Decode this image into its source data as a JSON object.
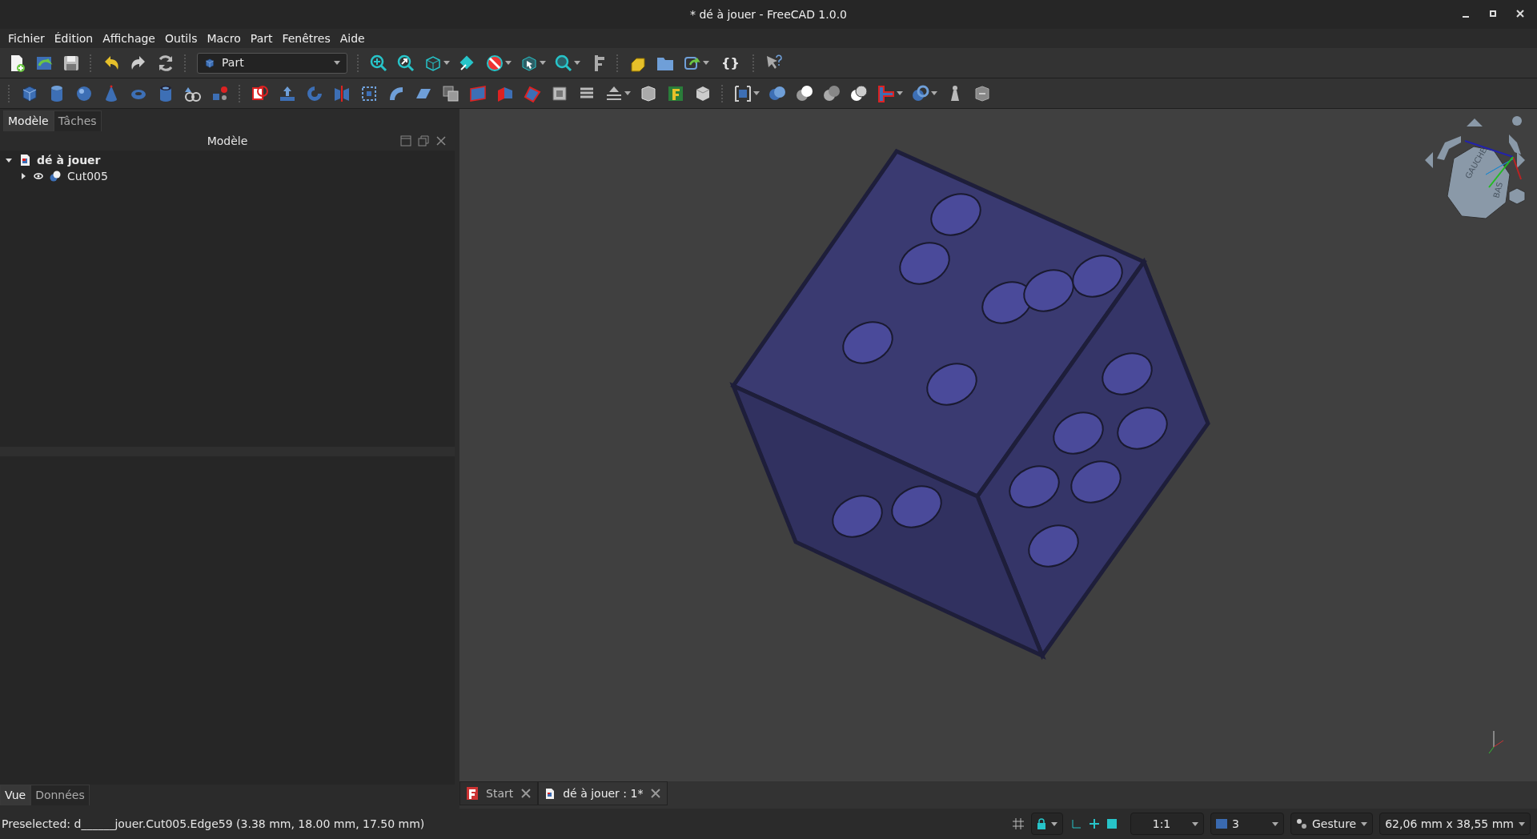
{
  "window": {
    "title": "* dé à jouer - FreeCAD 1.0.0"
  },
  "menu": [
    {
      "label": "Fichier"
    },
    {
      "label": "Édition"
    },
    {
      "label": "Affichage"
    },
    {
      "label": "Outils"
    },
    {
      "label": "Macro"
    },
    {
      "label": "Part"
    },
    {
      "label": "Fenêtres"
    },
    {
      "label": "Aide"
    }
  ],
  "toolbar": {
    "workbench": "Part",
    "macro_button": "{}"
  },
  "left_panel": {
    "tabs": [
      {
        "label": "Modèle",
        "selected": true
      },
      {
        "label": "Tâches",
        "selected": false
      }
    ],
    "title": "Modèle",
    "tree": [
      {
        "label": "dé à jouer",
        "expanded": true,
        "children": [
          {
            "label": "Cut005",
            "expanded": false,
            "visible": true
          }
        ]
      }
    ],
    "property_tabs": [
      {
        "label": "Vue",
        "selected": true
      },
      {
        "label": "Données",
        "selected": false
      }
    ]
  },
  "view": {
    "nav_cube_faces": [
      "GAUCHE",
      "BAS"
    ]
  },
  "document_tabs": [
    {
      "label": "Start",
      "selected": false
    },
    {
      "label": "dé à jouer : 1*",
      "selected": true
    }
  ],
  "status_bar": {
    "message": "Preselected: d______jouer.Cut005.Edge59 (3.38 mm, 18.00 mm, 17.50 mm)",
    "zoom": "1:1",
    "layer": "3",
    "navigation": "Gesture",
    "dimensions": "62,06 mm x 38,55 mm"
  }
}
